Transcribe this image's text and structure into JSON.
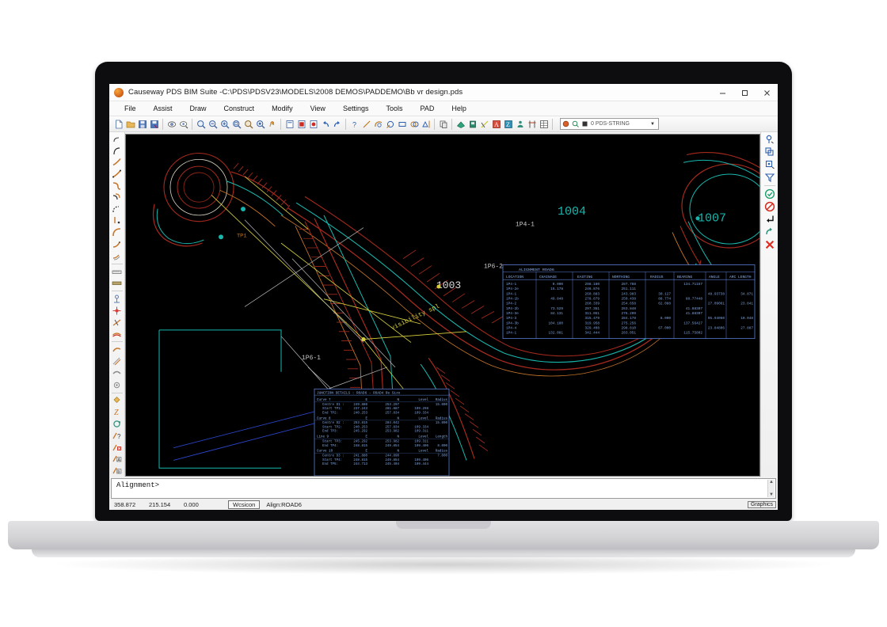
{
  "window": {
    "app_icon": "causeway-orb-icon",
    "title": "Causeway PDS BIM Suite -C:\\PDS\\PDSV23\\MODELS\\2008 DEMOS\\PADDEMO\\Bb vr design.pds",
    "controls": {
      "minimize": "minimize-icon",
      "maximize": "maximize-icon",
      "close": "close-icon"
    }
  },
  "menubar": {
    "items": [
      {
        "label": "File"
      },
      {
        "label": "Assist"
      },
      {
        "label": "Draw"
      },
      {
        "label": "Construct"
      },
      {
        "label": "Modify"
      },
      {
        "label": "View"
      },
      {
        "label": "Settings"
      },
      {
        "label": "Tools"
      },
      {
        "label": "PAD"
      },
      {
        "label": "Help"
      }
    ]
  },
  "toolbar": {
    "groups": [
      {
        "icons": [
          "new-document-icon",
          "open-folder-icon",
          "save-icon",
          "save-as-icon"
        ]
      },
      {
        "icons": [
          "print-preview-icon",
          "print-icon"
        ]
      },
      {
        "icons": [
          "zoom-window-icon",
          "zoom-out-icon",
          "zoom-in-icon",
          "zoom-all-icon",
          "zoom-previous-icon",
          "zoom-extents-icon",
          "pan-icon"
        ]
      },
      {
        "icons": [
          "layer-icon",
          "layer-off-icon",
          "layer-freeze-icon",
          "undo-icon",
          "redo-icon"
        ]
      },
      {
        "icons": [
          "query-icon",
          "line-icon",
          "arc-icon",
          "circle-icon",
          "rectangle-icon",
          "copy-object-icon",
          "mirror-icon"
        ]
      },
      {
        "icons": [
          "clone-icon"
        ]
      },
      {
        "icons": [
          "surface-icon",
          "volume-icon",
          "section-icon",
          "annotate-icon",
          "label-icon",
          "profile-icon",
          "levels-icon",
          "grid-table-icon"
        ]
      }
    ],
    "layer_combo": {
      "color_swatch_icon": "color-swatch-icon",
      "linetype_icon": "linetype-icon",
      "lineweight_icon": "lineweight-icon",
      "value": "0 PDS-STRING",
      "arrow_icon": "chevron-down-icon"
    }
  },
  "left_toolbar": {
    "items": [
      "string-start-icon",
      "string-curve-icon",
      "string-arc-icon",
      "string-bezier-icon",
      "string-spiral-icon",
      "string-offset-icon",
      "string-tangent-icon",
      "string-vertical-icon",
      "string-radius-icon",
      "string-fillet-icon",
      "string-sweep-icon",
      "ruler-icon",
      "level-strip-icon",
      "junction-icon",
      "node-icon",
      "kerb-icon",
      "carriageway-icon",
      "cross-section-icon",
      "hatch-icon",
      "pipe-icon",
      "drain-icon",
      "paint-bucket-icon",
      "text-style-icon",
      "rotate-icon",
      "query-line-icon",
      "delete-line-icon",
      "annotate-a-icon",
      "annotate-b-icon"
    ]
  },
  "right_toolbar": {
    "items": [
      "snap-node-icon",
      "snap-intersection-icon",
      "snap-midpoint-icon",
      "filter-icon",
      "accept-icon",
      "reject-icon",
      "enter-icon",
      "repeat-icon",
      "cancel-icon"
    ]
  },
  "command": {
    "prompt": "Alignment>",
    "scroll_up_icon": "scroll-up-icon",
    "scroll_down_icon": "scroll-down-icon"
  },
  "statusbar": {
    "x": "358.872",
    "y": "215.154",
    "z": "0.000",
    "wcsicon": "Wcsicon",
    "alignment": "Align:ROAD6",
    "mode": "Graphics"
  },
  "drawing": {
    "labels": [
      {
        "text": "1004",
        "color": "#2bd8c8"
      },
      {
        "text": "1003",
        "color": "#dcdcdc"
      },
      {
        "text": "1007",
        "color": "#2bd8c8"
      },
      {
        "text": "1P6-1",
        "color": "#c9c9c9"
      },
      {
        "text": "1P6-2",
        "color": "#c9c9c9"
      },
      {
        "text": "1P4-1",
        "color": "#c9c9c9"
      },
      {
        "text": "TP1",
        "color": "#c8761e"
      },
      {
        "text": "visibility spl",
        "color": "#d8d23a"
      }
    ],
    "colors": {
      "background": "#000000",
      "kerb_red": "#b32219",
      "alignment_teal": "#17b7ae",
      "dimension_yellow": "#d6cf3c",
      "annotation_grey": "#b9b9b9",
      "centreline_orange": "#c8761e",
      "blue_line": "#2b44c8",
      "table_blue": "#5c7fd6"
    }
  },
  "alignment_table": {
    "title": "ALIGNMENT ROAD6",
    "headers": [
      "LOCATION",
      "CHAINAGE",
      "EASTING",
      "NORTHING",
      "RADIUS",
      "BEARING",
      "ANGLE",
      "ARC LENGTH"
    ],
    "rows": [
      [
        "1P4-1",
        "0.000",
        "298.180",
        "287.788",
        "",
        "134.71157",
        "",
        ""
      ],
      [
        "1P4-2e",
        "15.178",
        "246.876",
        "251.111",
        "",
        "",
        "",
        ""
      ],
      [
        "1P4-1",
        "",
        "260.883",
        "243.983",
        "30.127",
        "",
        "48.93738",
        "34.871"
      ],
      [
        "1P4-1b",
        "49.848",
        "278.879",
        "250.438",
        "88.774",
        "88.77448",
        "",
        ""
      ],
      [
        "1P4-2",
        "",
        "260.339",
        "254.658",
        "62.088",
        "",
        "27.09061",
        "23.841"
      ],
      [
        "1P4-2b",
        "73.529",
        "297.351",
        "263.848",
        "",
        "41.88307",
        "",
        ""
      ],
      [
        "1P4-3e",
        "84.131",
        "311.051",
        "276.209",
        "",
        "41.88307",
        "",
        ""
      ],
      [
        "1P4-3",
        "",
        "315.479",
        "284.178",
        "8.000",
        "",
        "95.94060",
        "10.048"
      ],
      [
        "1P4-3b",
        "104.180",
        "319.958",
        "275.256",
        "",
        "137.56427",
        "",
        ""
      ],
      [
        "1P4-4",
        "",
        "329.408",
        "298.810",
        "67.000",
        "",
        "23.84806",
        "27.887"
      ],
      [
        "1P4-1",
        "132.081",
        "342.444",
        "283.051",
        "",
        "115.75802",
        "",
        ""
      ]
    ]
  },
  "junction_table": {
    "title": "JUNCTION DETAILS : ROAD6 - ROAD4   Re Size",
    "headers": [
      "",
      "E",
      "N",
      "Level",
      "Radius"
    ],
    "blocks": [
      {
        "name": "Curve 7",
        "rows": [
          [
            "Centre  D1 :",
            "249.880",
            "253.297",
            "",
            "15.000"
          ],
          [
            "Start  TP1:",
            "237.243",
            "281.887",
            "109.298",
            ""
          ],
          [
            "End    TP2:",
            "240.253",
            "257.834",
            "109.334",
            ""
          ]
        ]
      },
      {
        "name": "Curve 8",
        "rows": [
          [
            "Centre  D2 :",
            "253.815",
            "284.042",
            "",
            "15.000"
          ],
          [
            "Start  TP2:",
            "240.253",
            "257.834",
            "109.334",
            ""
          ],
          [
            "End    TP3:",
            "245.292",
            "253.982",
            "109.311",
            ""
          ]
        ]
      },
      {
        "name": "Line  9",
        "header_last": "Length",
        "rows": [
          [
            "Start  TP3:",
            "245.292",
            "253.982",
            "109.311",
            ""
          ],
          [
            "End    TP4:",
            "248.815",
            "249.854",
            "109.406",
            "8.000"
          ]
        ]
      },
      {
        "name": "Curve 10",
        "rows": [
          [
            "Centre  D3 :",
            "241.880",
            "244.890",
            "",
            "7.000"
          ],
          [
            "Start  TP4:",
            "248.815",
            "249.854",
            "109.406",
            ""
          ],
          [
            "End    TP5:",
            "244.713",
            "245.404",
            "109.444",
            ""
          ]
        ]
      }
    ]
  }
}
